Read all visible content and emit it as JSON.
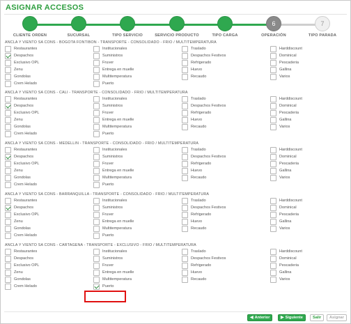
{
  "title": "ASIGNAR ACCESOS",
  "steps": [
    {
      "label": "CLIENTE ORDEN",
      "state": "done",
      "glyph": ""
    },
    {
      "label": "SUCURSAL",
      "state": "done",
      "glyph": ""
    },
    {
      "label": "TIPO SERVICIO",
      "state": "done",
      "glyph": ""
    },
    {
      "label": "SERVICIO PRODUCTO",
      "state": "done",
      "glyph": ""
    },
    {
      "label": "TIPO CARGA",
      "state": "done",
      "glyph": ""
    },
    {
      "label": "OPERACIÓN",
      "state": "current",
      "glyph": "6"
    },
    {
      "label": "TIPO PARADA",
      "state": "pending",
      "glyph": "7"
    }
  ],
  "columns": [
    [
      "Restaurantes",
      "Despachos",
      "Exclusivo OPL",
      "Zenu",
      "Gondolas",
      "Crem Helado"
    ],
    [
      "Institucionales",
      "Suministros",
      "Fruver",
      "Entrega en muelle",
      "Multitemperatura",
      "Puerto"
    ],
    [
      "Traslado",
      "Despachos Festivos",
      "Refrigerado",
      "Huevo",
      "Recaudo"
    ],
    [
      "Harddiscount",
      "Dominical",
      "Pescaderia",
      "Gallina",
      "Varios"
    ]
  ],
  "sections": [
    {
      "title": "ANCLA Y VIENTO SA CONS - BOGOTA FONTIBON - TRANSPORTE - CONSOLIDADO - FRIO / MULTITEMPERATURA",
      "checked": [
        "Despachos"
      ]
    },
    {
      "title": "ANCLA Y VIENTO SA CONS - CALI - TRANSPORTE - CONSOLIDADO - FRIO / MULTITEMPERATURA",
      "checked": [
        "Despachos"
      ]
    },
    {
      "title": "ANCLA Y VIENTO SA CONS - MEDELLIN - TRANSPORTE - CONSOLIDADO - FRIO / MULTITEMPERATURA",
      "checked": [
        "Despachos"
      ]
    },
    {
      "title": "ANCLA Y VIENTO SA CONS - BARRANQUILLA - TRANSPORTE - CONSOLIDADO - FRIO / MULTITEMPERATURA",
      "checked": [
        "Despachos"
      ]
    },
    {
      "title": "ANCLA Y VIENTO SA CONS - CARTAGENA - TRANSPORTE - EXCLUSIVO - FRIO / MULTITEMPERATURA",
      "checked": [
        "Puerto"
      ]
    }
  ],
  "footer": {
    "anterior": "Anterior",
    "siguiente": "Siguiente",
    "salir": "Salir",
    "asignar": "Asignar"
  },
  "colors": {
    "accent": "#2fa84f",
    "current_step": "#8a8a8a",
    "highlight": "#e01010"
  }
}
